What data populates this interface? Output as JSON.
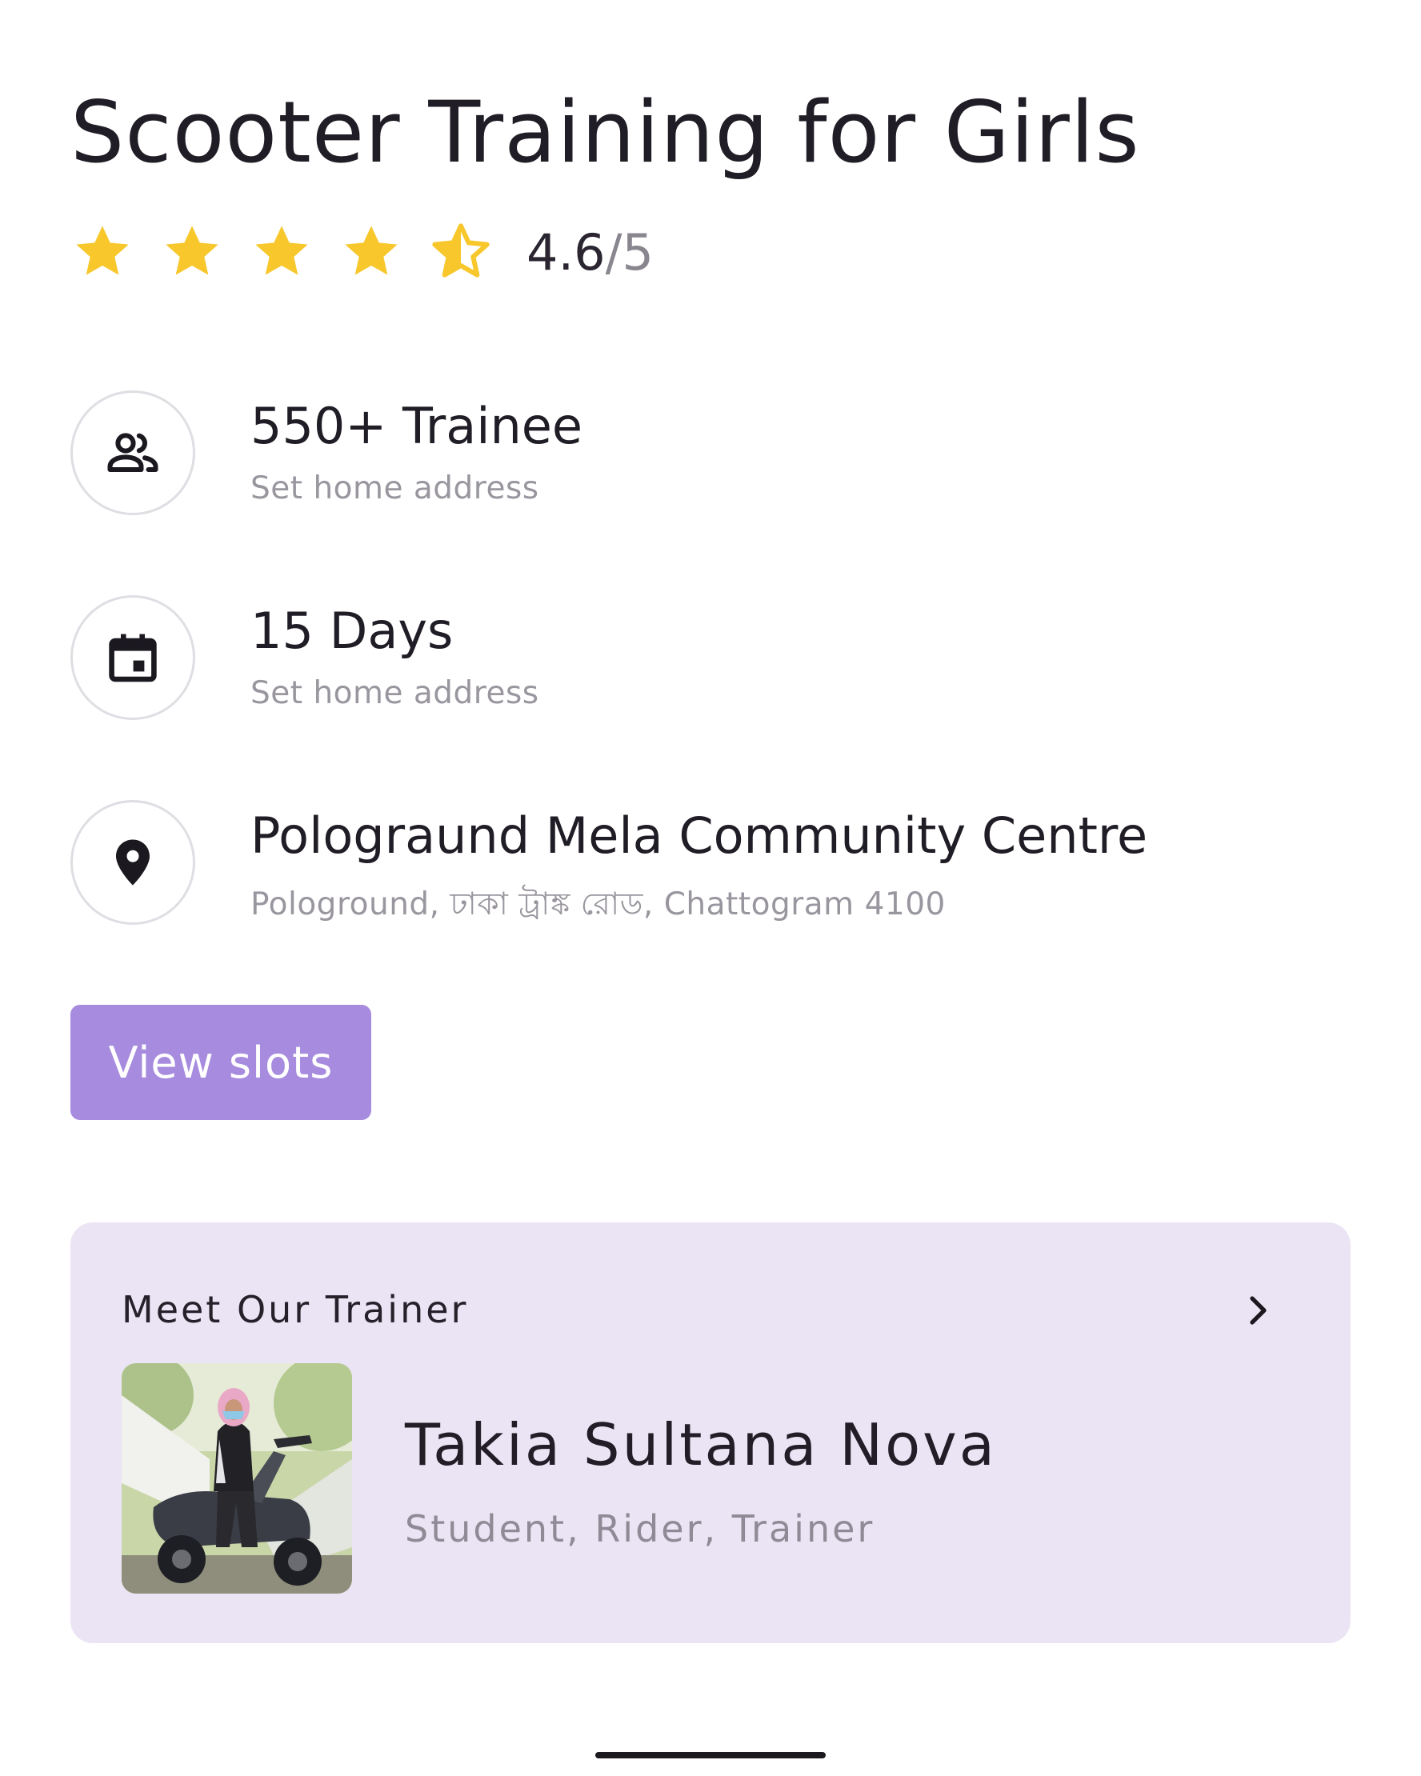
{
  "course": {
    "title": "Scooter Training for Girls"
  },
  "rating": {
    "value": "4.6",
    "max": "/5",
    "stars": 4.6,
    "star_color": "#F7C72B"
  },
  "info": [
    {
      "icon": "group-icon",
      "title": "550+ Trainee",
      "subtitle": "Set home address"
    },
    {
      "icon": "calendar-icon",
      "title": "15 Days",
      "subtitle": "Set home address"
    },
    {
      "icon": "location-pin-icon",
      "title": "Polograund Mela Community Centre",
      "subtitle": "Pologround, ঢাকা ট্রাঙ্ক রোড, Chattogram 4100"
    }
  ],
  "actions": {
    "view_slots_label": "View slots"
  },
  "trainer": {
    "section_title": "Meet Our Trainer",
    "name": "Takia Sultana Nova",
    "roles": "Student, Rider, Trainer"
  },
  "colors": {
    "accent": "#A78BDE",
    "card_background": "#EBE4F4",
    "text_primary": "#211D26",
    "text_secondary": "#9A969F"
  }
}
